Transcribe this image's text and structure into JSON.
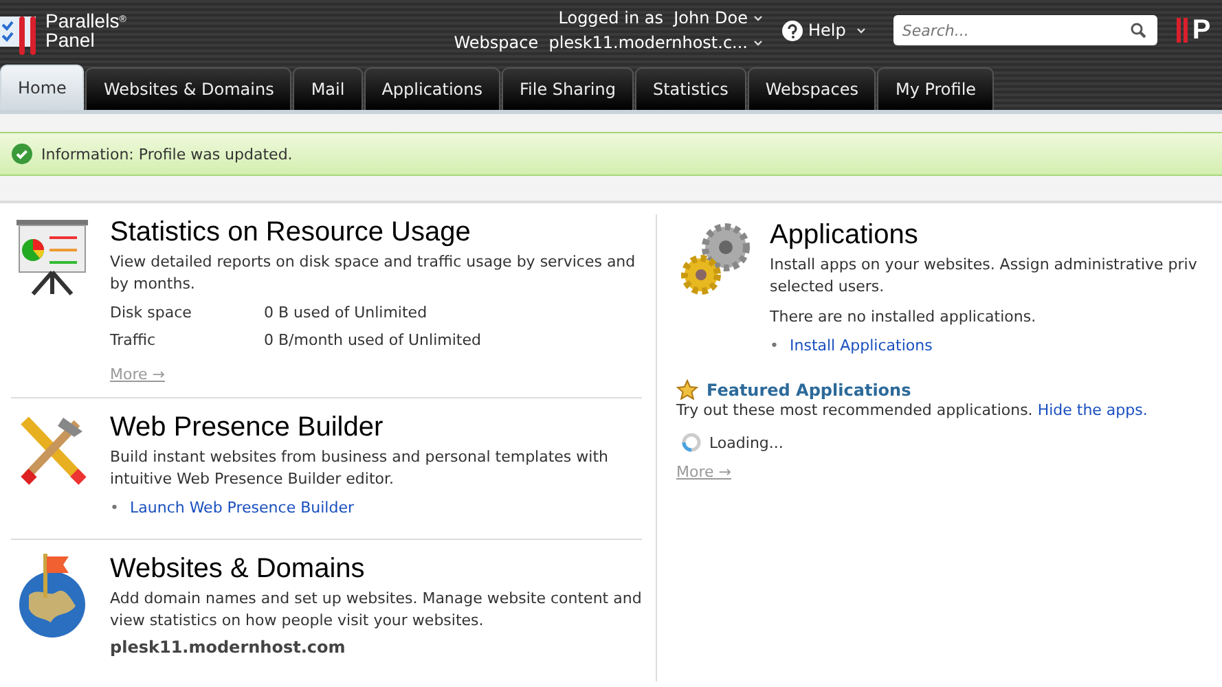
{
  "header": {
    "logo_line1": "Parallels",
    "logo_reg": "®",
    "logo_line2": "Panel",
    "logged_label": "Logged in as",
    "user": "John Doe",
    "webspace_label": "Webspace",
    "webspace": "plesk11.modernhost.c...",
    "help": "Help",
    "search": {
      "placeholder": "Search..."
    },
    "brand_mark": "P"
  },
  "tabs": [
    {
      "label": "Home",
      "selected": true
    },
    {
      "label": "Websites & Domains",
      "selected": false
    },
    {
      "label": "Mail",
      "selected": false
    },
    {
      "label": "Applications",
      "selected": false
    },
    {
      "label": "File Sharing",
      "selected": false
    },
    {
      "label": "Statistics",
      "selected": false
    },
    {
      "label": "Webspaces",
      "selected": false
    },
    {
      "label": "My Profile",
      "selected": false
    }
  ],
  "message": {
    "label": "Information:",
    "text": "Profile was updated."
  },
  "left_sections": [
    {
      "kind": "stats",
      "title": "Statistics on Resource Usage",
      "description": "View detailed reports on disk space and traffic usage by services and by months.",
      "stats": [
        {
          "name": "Disk space",
          "value": "0 B used of Unlimited"
        },
        {
          "name": "Traffic",
          "value": "0 B/month used of Unlimited"
        }
      ],
      "more": "More →"
    },
    {
      "kind": "builder",
      "title": "Web Presence Builder",
      "description": "Build instant websites from business and personal templates with intuitive Web Presence Builder editor.",
      "links": [
        {
          "bullet": "•",
          "text": "Launch Web Presence Builder"
        }
      ]
    },
    {
      "kind": "domains",
      "title": "Websites & Domains",
      "description": "Add domain names and set up websites. Manage website content and view statistics on how people visit your websites.",
      "domain": "plesk11.modernhost.com"
    }
  ],
  "applications": {
    "title": "Applications",
    "description_lines": [
      "Install apps on your websites. Assign administrative priv",
      "selected users."
    ],
    "status": "There are no installed applications.",
    "links": [
      {
        "bullet": "•",
        "text": "Install Applications"
      }
    ],
    "featured_title": "Featured Applications",
    "featured_text": "Try out these most recommended applications.",
    "hide_link": "Hide the apps.",
    "loading": "Loading...",
    "more": "More →"
  }
}
